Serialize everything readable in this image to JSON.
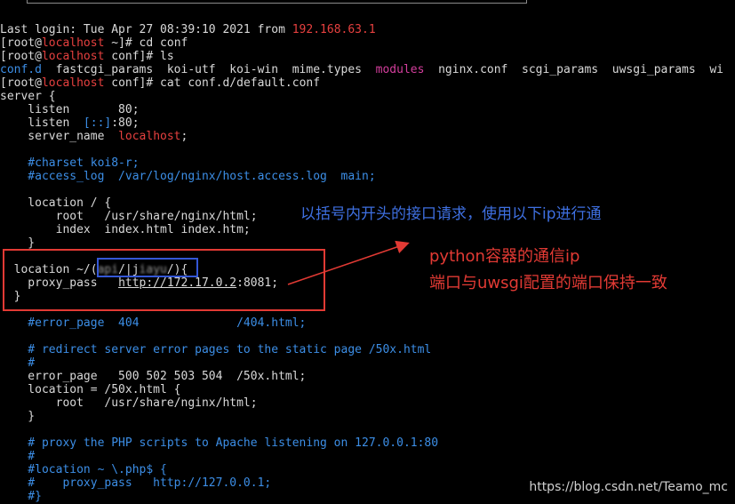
{
  "terminal": {
    "lines": [
      {
        "segments": [
          {
            "t": "Last login: Tue Apr 27 08:39:10 2021 from ",
            "c": "g"
          },
          {
            "t": "192.168.63.1",
            "c": "ip"
          }
        ]
      },
      {
        "segments": [
          {
            "t": "[root@",
            "c": "g"
          },
          {
            "t": "localhost",
            "c": "host"
          },
          {
            "t": " ~]# cd conf",
            "c": "g"
          }
        ]
      },
      {
        "segments": [
          {
            "t": "[root@",
            "c": "g"
          },
          {
            "t": "localhost",
            "c": "host"
          },
          {
            "t": " conf]# ls",
            "c": "g"
          }
        ]
      },
      {
        "segments": [
          {
            "t": "conf.d",
            "c": "dir"
          },
          {
            "t": "  fastcgi_params  koi-utf  koi-win  mime.types  ",
            "c": "g"
          },
          {
            "t": "modules",
            "c": "modules"
          },
          {
            "t": "  nginx.conf  scgi_params  uwsgi_params  wi",
            "c": "g"
          }
        ]
      },
      {
        "segments": [
          {
            "t": "[root@",
            "c": "g"
          },
          {
            "t": "localhost",
            "c": "host"
          },
          {
            "t": " conf]# cat conf.d/default.conf",
            "c": "g"
          }
        ]
      },
      {
        "segments": [
          {
            "t": "server {",
            "c": "g"
          }
        ]
      },
      {
        "segments": [
          {
            "t": "    listen       80;",
            "c": "g"
          }
        ]
      },
      {
        "segments": [
          {
            "t": "    listen  ",
            "c": "g"
          },
          {
            "t": "[::]",
            "c": "dir"
          },
          {
            "t": ":80;",
            "c": "g"
          }
        ]
      },
      {
        "segments": [
          {
            "t": "    server_name  ",
            "c": "g"
          },
          {
            "t": "localhost",
            "c": "val"
          },
          {
            "t": ";",
            "c": "g"
          }
        ]
      },
      {
        "segments": [
          {
            "t": "",
            "c": "g"
          }
        ]
      },
      {
        "segments": [
          {
            "t": "    #charset koi8-r;",
            "c": "comment"
          }
        ]
      },
      {
        "segments": [
          {
            "t": "    #access_log  /var/log/nginx/host.access.log  main;",
            "c": "comment"
          }
        ]
      },
      {
        "segments": [
          {
            "t": "",
            "c": "g"
          }
        ]
      },
      {
        "segments": [
          {
            "t": "    location / {",
            "c": "g"
          }
        ]
      },
      {
        "segments": [
          {
            "t": "        root   /usr/share/nginx/html;",
            "c": "g"
          }
        ]
      },
      {
        "segments": [
          {
            "t": "        index  index.html index.htm;",
            "c": "g"
          }
        ]
      },
      {
        "segments": [
          {
            "t": "    }",
            "c": "g"
          }
        ]
      },
      {
        "segments": [
          {
            "t": "",
            "c": "g"
          }
        ]
      },
      {
        "segments": [
          {
            "t": "  location ~/(",
            "c": "g"
          },
          {
            "t": "api",
            "c": "blurred"
          },
          {
            "t": "/|j",
            "c": "g"
          },
          {
            "t": "iayu",
            "c": "blurred"
          },
          {
            "t": "/){",
            "c": "g"
          }
        ]
      },
      {
        "segments": [
          {
            "t": "    proxy_pass   ",
            "c": "g"
          },
          {
            "t": "http://172.17.0.2",
            "c": "url"
          },
          {
            "t": ":8081;",
            "c": "g"
          }
        ]
      },
      {
        "segments": [
          {
            "t": "  }",
            "c": "g"
          }
        ]
      },
      {
        "segments": [
          {
            "t": "",
            "c": "g"
          }
        ]
      },
      {
        "segments": [
          {
            "t": "    #error_page  404              /404.html;",
            "c": "comment"
          }
        ]
      },
      {
        "segments": [
          {
            "t": "",
            "c": "g"
          }
        ]
      },
      {
        "segments": [
          {
            "t": "    # redirect server error pages to the static page /50x.html",
            "c": "comment"
          }
        ]
      },
      {
        "segments": [
          {
            "t": "    #",
            "c": "comment"
          }
        ]
      },
      {
        "segments": [
          {
            "t": "    error_page   500 502 503 504  /50x.html;",
            "c": "g"
          }
        ]
      },
      {
        "segments": [
          {
            "t": "    location = /50x.html {",
            "c": "g"
          }
        ]
      },
      {
        "segments": [
          {
            "t": "        root   /usr/share/nginx/html;",
            "c": "g"
          }
        ]
      },
      {
        "segments": [
          {
            "t": "    }",
            "c": "g"
          }
        ]
      },
      {
        "segments": [
          {
            "t": "",
            "c": "g"
          }
        ]
      },
      {
        "segments": [
          {
            "t": "    # proxy the PHP scripts to Apache listening on 127.0.0.1:80",
            "c": "comment"
          }
        ]
      },
      {
        "segments": [
          {
            "t": "    #",
            "c": "comment"
          }
        ]
      },
      {
        "segments": [
          {
            "t": "    #location ~ \\.php$ {",
            "c": "comment"
          }
        ]
      },
      {
        "segments": [
          {
            "t": "    #    proxy_pass   http://127.0.0.1;",
            "c": "comment"
          }
        ]
      },
      {
        "segments": [
          {
            "t": "    #}",
            "c": "comment"
          }
        ]
      }
    ]
  },
  "annotations": {
    "blue_note": "以括号内开头的接口请求，使用以下ip进行通",
    "red_note_1": "python容器的通信ip",
    "red_note_2": "端口与uwsgi配置的端口保持一致"
  },
  "watermark": "https://blog.csdn.net/Teamo_mc",
  "colors": {
    "background": "#000000",
    "text": "#d9d9d9",
    "hostname_red": "#e6403f",
    "comment_blue": "#3c8ee6",
    "modules_magenta": "#d33e9c",
    "annotation_red": "#e23a34",
    "annotation_blue": "#3e6fe0"
  }
}
